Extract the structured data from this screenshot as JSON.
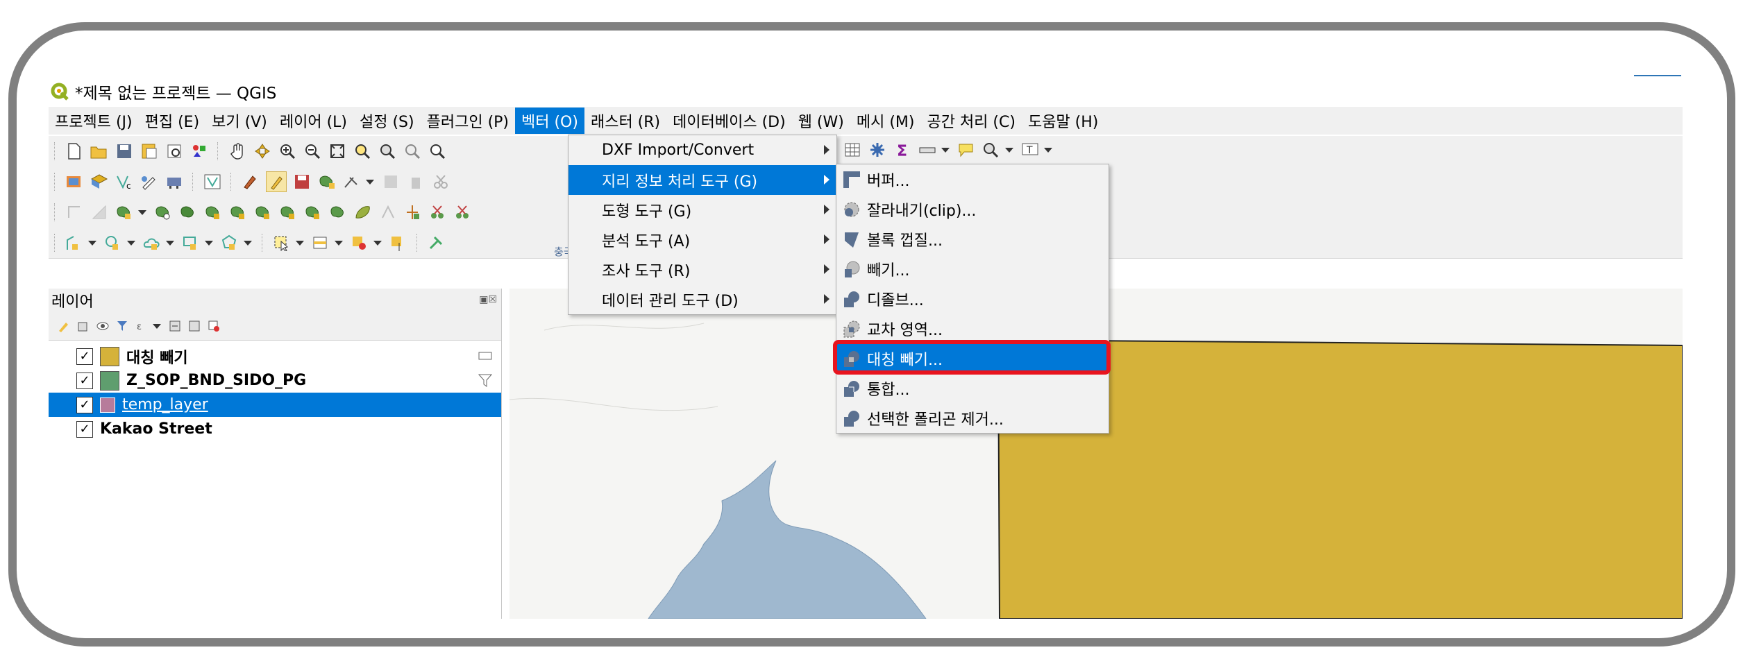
{
  "window": {
    "title": "*제목 없는 프로젝트 — QGIS"
  },
  "menubar": [
    {
      "label": "프로젝트 (J)"
    },
    {
      "label": "편집 (E)"
    },
    {
      "label": "보기 (V)"
    },
    {
      "label": "레이어 (L)"
    },
    {
      "label": "설정 (S)"
    },
    {
      "label": "플러그인 (P)"
    },
    {
      "label": "벡터 (O)",
      "active": true
    },
    {
      "label": "래스터 (R)"
    },
    {
      "label": "데이터베이스 (D)"
    },
    {
      "label": "웹 (W)"
    },
    {
      "label": "메시 (M)"
    },
    {
      "label": "공간 처리 (C)"
    },
    {
      "label": "도움말 (H)"
    }
  ],
  "vector_menu": [
    {
      "label": "DXF Import/Convert",
      "has_submenu": true
    },
    {
      "label": "지리 정보 처리 도구 (G)",
      "has_submenu": true,
      "highlighted": true
    },
    {
      "label": "도형 도구 (G)",
      "has_submenu": true
    },
    {
      "label": "분석 도구 (A)",
      "has_submenu": true
    },
    {
      "label": "조사 도구 (R)",
      "has_submenu": true
    },
    {
      "label": "데이터 관리 도구 (D)",
      "has_submenu": true
    }
  ],
  "geoprocessing_submenu": [
    {
      "label": "버퍼...",
      "icon": "buffer-icon"
    },
    {
      "label": "잘라내기(clip)...",
      "icon": "clip-icon"
    },
    {
      "label": "볼록 껍질...",
      "icon": "convex-hull-icon"
    },
    {
      "label": "빼기...",
      "icon": "difference-icon"
    },
    {
      "label": "디졸브...",
      "icon": "dissolve-icon"
    },
    {
      "label": "교차 영역...",
      "icon": "intersection-icon"
    },
    {
      "label": "대칭 빼기...",
      "icon": "symmetrical-difference-icon",
      "highlighted": true
    },
    {
      "label": "통합...",
      "icon": "union-icon"
    },
    {
      "label": "선택한 폴리곤 제거...",
      "icon": "eliminate-polygons-icon"
    }
  ],
  "layers_panel": {
    "title": "레이어",
    "layers": [
      {
        "name": "대칭 빼기",
        "checked": true,
        "color": "#d5b23a"
      },
      {
        "name": "Z_SOP_BND_SIDO_PG",
        "checked": true,
        "color": "#5f9e6e"
      },
      {
        "name": "temp_layer",
        "checked": true,
        "selected": true,
        "color": "#b77b9b"
      },
      {
        "name": "Kakao Street",
        "checked": true
      }
    ]
  },
  "map": {
    "label": "충국",
    "polygon_color": "#d5b23a",
    "water_color": "#9fb8cf"
  }
}
